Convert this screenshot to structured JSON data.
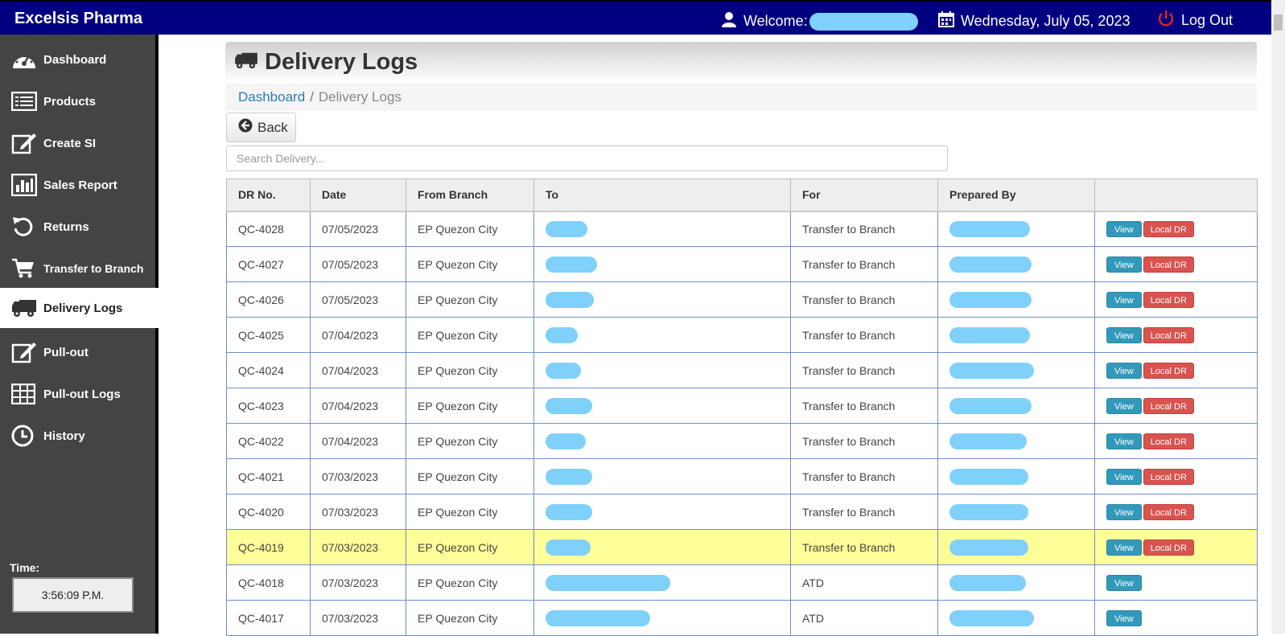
{
  "header": {
    "brand": "Excelsis Pharma",
    "welcome": "Welcome:",
    "date": "Wednesday, July 05, 2023",
    "logout": "Log Out",
    "accent": "#000080"
  },
  "sidebar": {
    "items": [
      {
        "label": "Dashboard",
        "icon": "dashboard-icon"
      },
      {
        "label": "Products",
        "icon": "list-icon"
      },
      {
        "label": "Create SI",
        "icon": "edit-icon"
      },
      {
        "label": "Sales Report",
        "icon": "bar-chart-icon"
      },
      {
        "label": "Returns",
        "icon": "undo-icon"
      },
      {
        "label": "Transfer to Branch",
        "icon": "cart-icon"
      },
      {
        "label": "Delivery Logs",
        "icon": "truck-icon",
        "active": true
      },
      {
        "label": "Pull-out",
        "icon": "edit-icon"
      },
      {
        "label": "Pull-out Logs",
        "icon": "grid-icon"
      },
      {
        "label": "History",
        "icon": "clock-icon"
      }
    ],
    "time_label": "Time:",
    "time_value": "3:56:09 P.M."
  },
  "page": {
    "title": "Delivery Logs",
    "breadcrumb_home": "Dashboard",
    "breadcrumb_sep": "/",
    "breadcrumb_current": "Delivery Logs",
    "back": "Back",
    "search_placeholder": "Search Delivery..."
  },
  "table": {
    "headers": [
      "DR No.",
      "Date",
      "From Branch",
      "To",
      "For",
      "Prepared By",
      ""
    ],
    "rows": [
      {
        "dr": "QC-4028",
        "date": "07/05/2023",
        "from": "EP Quezon City",
        "for": "Transfer to Branch",
        "local": true,
        "highlight": false
      },
      {
        "dr": "QC-4027",
        "date": "07/05/2023",
        "from": "EP Quezon City",
        "for": "Transfer to Branch",
        "local": true,
        "highlight": false
      },
      {
        "dr": "QC-4026",
        "date": "07/05/2023",
        "from": "EP Quezon City",
        "for": "Transfer to Branch",
        "local": true,
        "highlight": false
      },
      {
        "dr": "QC-4025",
        "date": "07/04/2023",
        "from": "EP Quezon City",
        "for": "Transfer to Branch",
        "local": true,
        "highlight": false
      },
      {
        "dr": "QC-4024",
        "date": "07/04/2023",
        "from": "EP Quezon City",
        "for": "Transfer to Branch",
        "local": true,
        "highlight": false
      },
      {
        "dr": "QC-4023",
        "date": "07/04/2023",
        "from": "EP Quezon City",
        "for": "Transfer to Branch",
        "local": true,
        "highlight": false
      },
      {
        "dr": "QC-4022",
        "date": "07/04/2023",
        "from": "EP Quezon City",
        "for": "Transfer to Branch",
        "local": true,
        "highlight": false
      },
      {
        "dr": "QC-4021",
        "date": "07/03/2023",
        "from": "EP Quezon City",
        "for": "Transfer to Branch",
        "local": true,
        "highlight": false
      },
      {
        "dr": "QC-4020",
        "date": "07/03/2023",
        "from": "EP Quezon City",
        "for": "Transfer to Branch",
        "local": true,
        "highlight": false
      },
      {
        "dr": "QC-4019",
        "date": "07/03/2023",
        "from": "EP Quezon City",
        "for": "Transfer to Branch",
        "local": true,
        "highlight": true
      },
      {
        "dr": "QC-4018",
        "date": "07/03/2023",
        "from": "EP Quezon City",
        "for": "ATD",
        "local": false,
        "highlight": false
      },
      {
        "dr": "QC-4017",
        "date": "07/03/2023",
        "from": "EP Quezon City",
        "for": "ATD",
        "local": false,
        "highlight": false
      }
    ],
    "view_label": "View",
    "local_label": "Local DR"
  }
}
